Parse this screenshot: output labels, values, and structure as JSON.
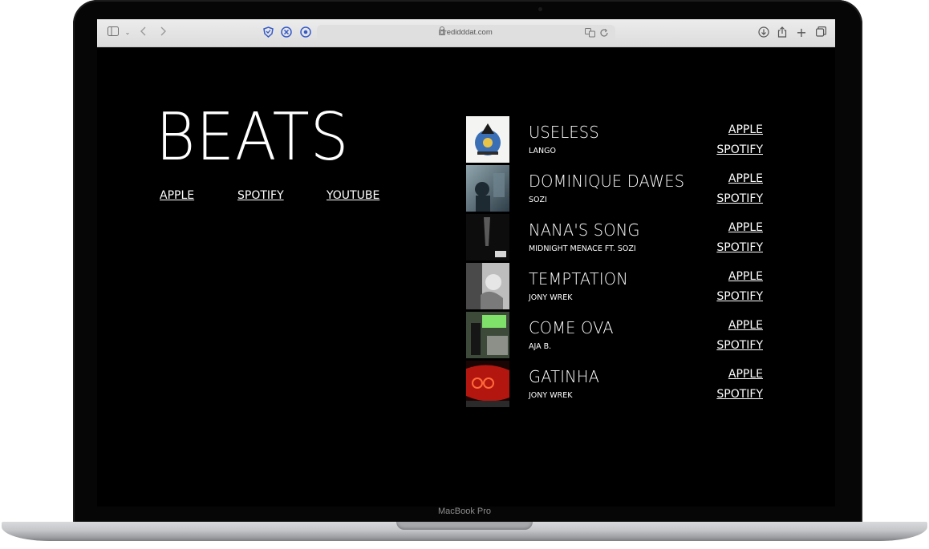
{
  "device": {
    "label": "MacBook Pro"
  },
  "browser": {
    "url": "dredidddat.com",
    "toolbar_icons": [
      "sidebar-icon",
      "chevron-down-icon",
      "back-icon",
      "forward-icon",
      "shield-icon",
      "extension-icon",
      "refresh-extension-icon",
      "translate-icon",
      "reload-icon",
      "download-icon",
      "share-icon",
      "new-tab-icon",
      "tabs-overview-icon"
    ]
  },
  "page": {
    "title": "BEATS",
    "links": [
      "APPLE",
      "SPOTIFY",
      "YOUTUBE"
    ],
    "tracks": [
      {
        "title": "USELESS",
        "artist": "LANGO",
        "apple": "APPLE",
        "spotify": "SPOTIFY"
      },
      {
        "title": "DOMINIQUE DAWES",
        "artist": "SOZI",
        "apple": "APPLE",
        "spotify": "SPOTIFY"
      },
      {
        "title": "NANA'S SONG",
        "artist": "MIDNIGHT MENACE FT. SOZI",
        "apple": "APPLE",
        "spotify": "SPOTIFY"
      },
      {
        "title": "TEMPTATION",
        "artist": "JONY WREK",
        "apple": "APPLE",
        "spotify": "SPOTIFY"
      },
      {
        "title": "COME OVA",
        "artist": "AJA B.",
        "apple": "APPLE",
        "spotify": "SPOTIFY"
      },
      {
        "title": "GATINHA",
        "artist": "JONY WREK",
        "apple": "APPLE",
        "spotify": "SPOTIFY"
      }
    ]
  },
  "colors": {
    "background": "#000000",
    "text": "#ffffff",
    "toolbar": "#e4e4e4",
    "accent_icon": "#3459c9"
  }
}
